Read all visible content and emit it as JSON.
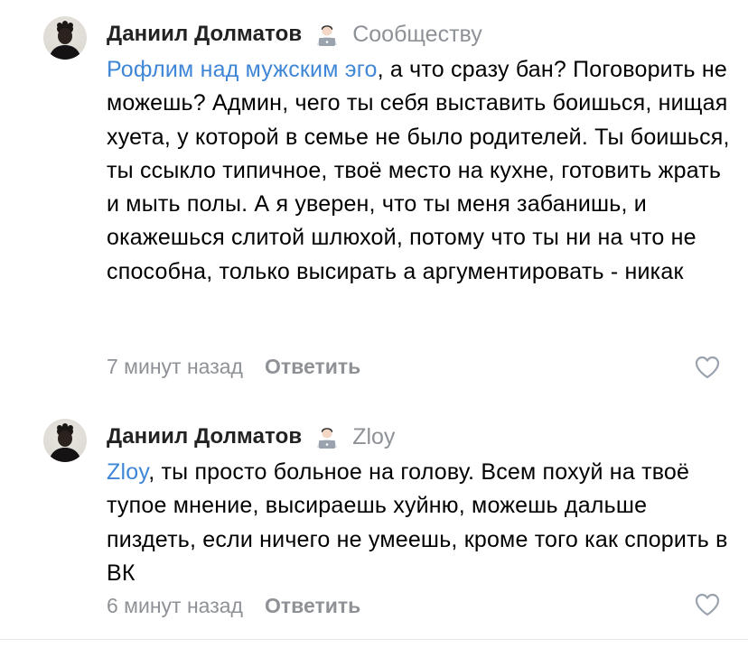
{
  "comments": [
    {
      "author": "Даниил Долматов",
      "author_emoji": "technologist-emoji",
      "reply_to": "Сообществу",
      "mention": "Рофлим над мужским эго",
      "text": ", а что сразу бан? Поговорить не можешь? Админ, чего ты себя выставить боишься, нищая хуета, у которой в семье не было родителей. Ты боишься, ты ссыкло типичное, твоё место на кухне, готовить жрать и мыть полы. А я уверен, что ты меня забанишь, и окажешься слитой шлюхой, потому что ты ни на что не способна, только высирать а аргументировать - никак",
      "time": "7 минут назад",
      "reply_label": "Ответить",
      "like_icon": "heart-outline-icon"
    },
    {
      "author": "Даниил Долматов",
      "author_emoji": "technologist-emoji",
      "reply_to": "Zloy",
      "mention": "Zloy",
      "text": ", ты просто больное на голову. Всем похуй на твоё тупое мнение, высираешь хуйню, можешь дальше пиздеть, если ничего не умеешь, кроме того как спорить в ВК",
      "time": "6 минут назад",
      "reply_label": "Ответить",
      "like_icon": "heart-outline-icon"
    }
  ],
  "colors": {
    "mention": "#3f86d6",
    "secondary_text": "#8e9297",
    "author": "#222222"
  }
}
